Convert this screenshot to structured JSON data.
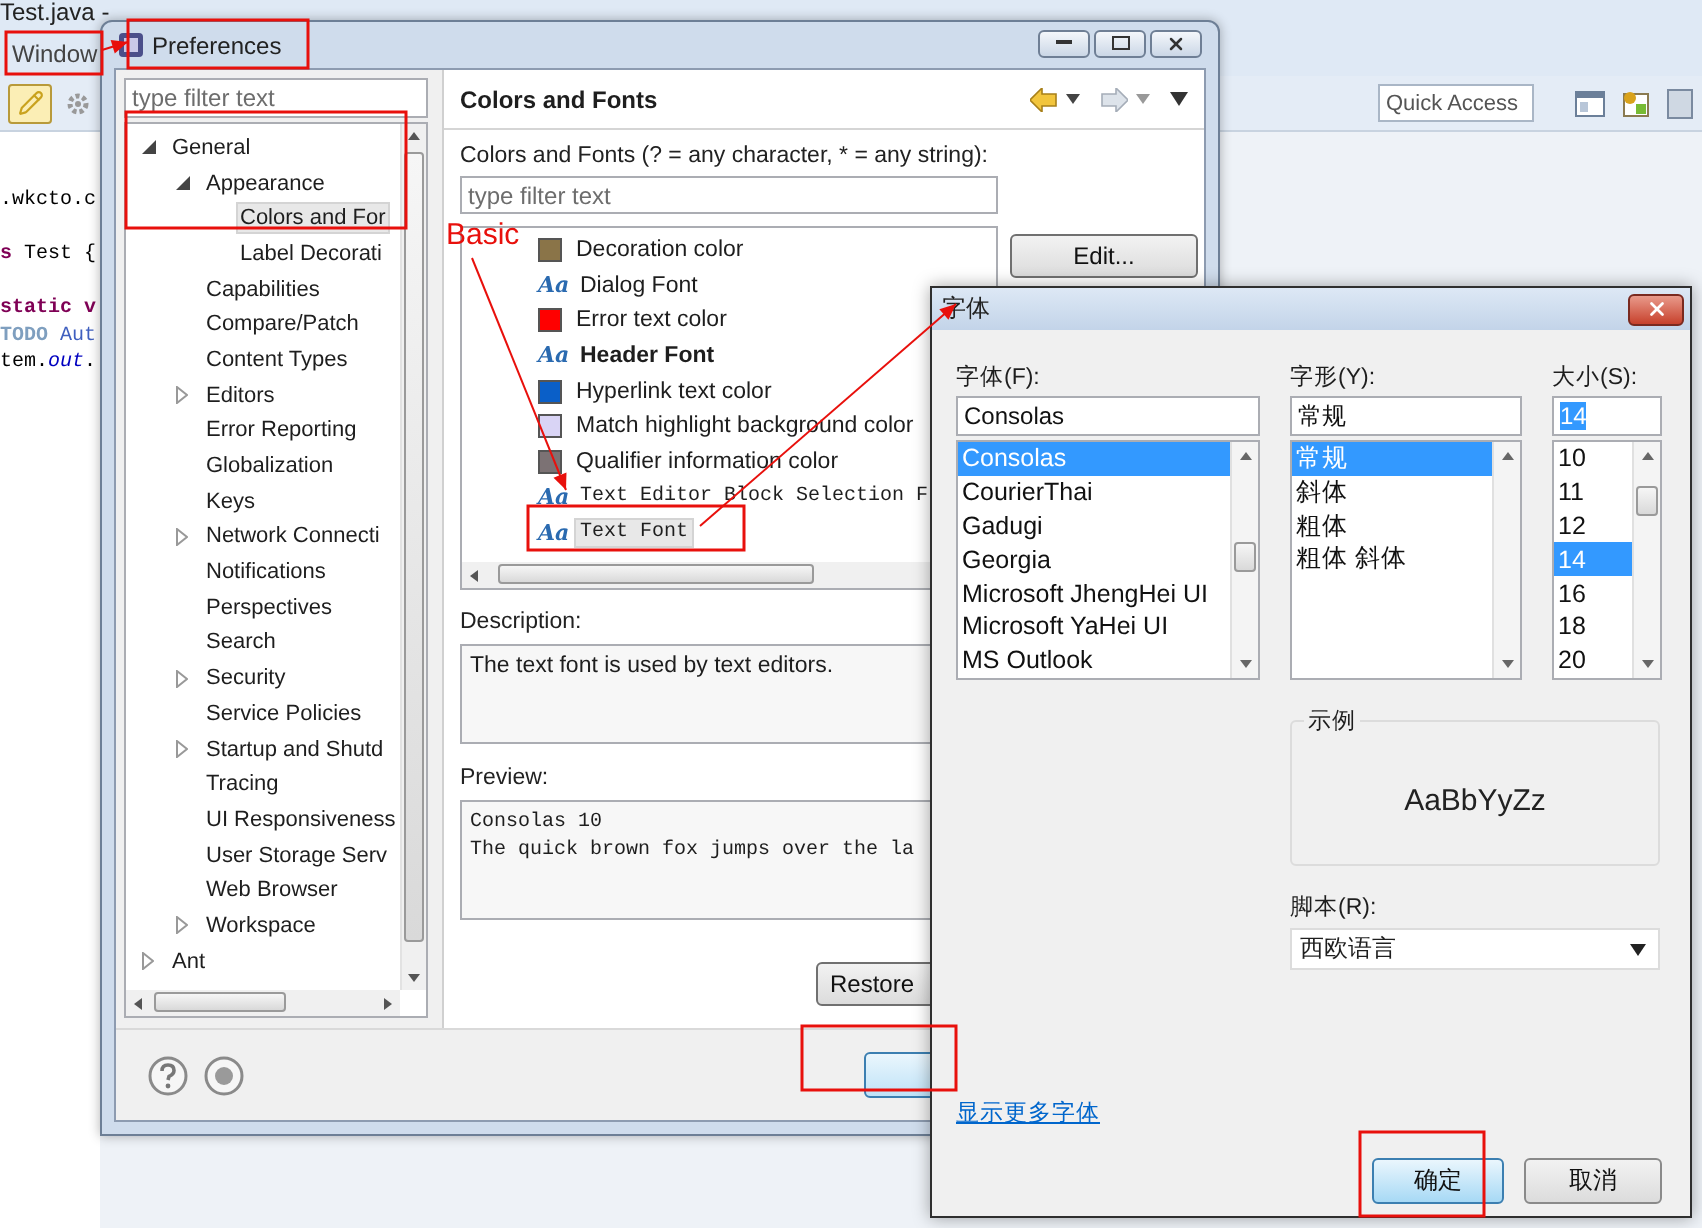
{
  "editor": {
    "title": "Test.java -",
    "menu": [
      {
        "label": "Window"
      }
    ],
    "quick_access": {
      "placeholder": "Quick Access"
    },
    "code_lines": [
      {
        "segments": [
          {
            "text": ".wkcto.c",
            "kind": "plain"
          }
        ]
      },
      {
        "segments": [
          {
            "text": "s",
            "kind": "keyword"
          },
          {
            "text": " Test {",
            "kind": "plain"
          }
        ]
      },
      {
        "segments": [
          {
            "text": "static v",
            "kind": "keyword"
          }
        ]
      },
      {
        "segments": [
          {
            "text": "TODO",
            "kind": "comment_tag"
          },
          {
            "text": " Aut",
            "kind": "comment"
          }
        ]
      },
      {
        "segments": [
          {
            "text": "tem.",
            "kind": "plain"
          },
          {
            "text": "out",
            "kind": "field"
          },
          {
            "text": ".",
            "kind": "plain"
          }
        ]
      }
    ]
  },
  "preferences": {
    "title": "Preferences",
    "filter": {
      "placeholder": "type filter text"
    },
    "tree": [
      {
        "label": "General",
        "expanded": true,
        "selected": false,
        "children": [
          {
            "label": "Appearance",
            "expanded": true,
            "selected": false,
            "children": [
              {
                "label": "Colors and For",
                "selected": true
              },
              {
                "label": "Label Decorati",
                "selected": false
              }
            ]
          },
          {
            "label": "Capabilities",
            "selected": false
          },
          {
            "label": "Compare/Patch",
            "selected": false
          },
          {
            "label": "Content Types",
            "selected": false
          },
          {
            "label": "Editors",
            "expanded": false,
            "selected": false
          },
          {
            "label": "Error Reporting",
            "selected": false
          },
          {
            "label": "Globalization",
            "selected": false
          },
          {
            "label": "Keys",
            "selected": false
          },
          {
            "label": "Network Connecti",
            "expanded": false,
            "selected": false
          },
          {
            "label": "Notifications",
            "selected": false
          },
          {
            "label": "Perspectives",
            "selected": false
          },
          {
            "label": "Search",
            "selected": false
          },
          {
            "label": "Security",
            "expanded": false,
            "selected": false
          },
          {
            "label": "Service Policies",
            "selected": false
          },
          {
            "label": "Startup and Shutd",
            "expanded": false,
            "selected": false
          },
          {
            "label": "Tracing",
            "selected": false
          },
          {
            "label": "UI Responsiveness",
            "selected": false
          },
          {
            "label": "User Storage Serv",
            "selected": false
          },
          {
            "label": "Web Browser",
            "selected": false
          },
          {
            "label": "Workspace",
            "expanded": false,
            "selected": false
          }
        ]
      },
      {
        "label": "Ant",
        "expanded": false,
        "selected": false
      }
    ],
    "page": {
      "title": "Colors and Fonts",
      "filter_label": "Colors and Fonts (? = any character, * = any string):",
      "filter": {
        "placeholder": "type filter text"
      },
      "items": [
        {
          "kind": "color",
          "label": "Decoration color",
          "color": "#8a7448",
          "selected": false
        },
        {
          "kind": "font",
          "glyph": "Aa",
          "label": "Dialog Font",
          "bold": false,
          "fixed_width": false,
          "selected": false
        },
        {
          "kind": "color",
          "label": "Error text color",
          "color": "#ff0000",
          "selected": false
        },
        {
          "kind": "font",
          "glyph": "Aa",
          "label": "Header Font",
          "bold": true,
          "fixed_width": false,
          "selected": false
        },
        {
          "kind": "color",
          "label": "Hyperlink text color",
          "color": "#0a5fc8",
          "selected": false
        },
        {
          "kind": "color",
          "label": "Match highlight background color",
          "color": "#d9d4f5",
          "selected": false
        },
        {
          "kind": "color",
          "label": "Qualifier information color",
          "color": "#7c7274",
          "selected": false
        },
        {
          "kind": "font",
          "glyph": "Aa",
          "label": "Text Editor Block Selection F",
          "bold": false,
          "fixed_width": true,
          "selected": false
        },
        {
          "kind": "font",
          "glyph": "Aa",
          "label": "Text Font",
          "bold": false,
          "fixed_width": true,
          "selected": true
        }
      ],
      "edit_button": "Edit...",
      "description_label": "Description:",
      "description": "The text font is used by text editors.",
      "preview_label": "Preview:",
      "preview": [
        "Consolas 10",
        "The quick brown fox jumps over the la"
      ],
      "restore_button": "Restore"
    }
  },
  "font_dialog": {
    "title": "字体",
    "columns": [
      {
        "label": "字体(F):",
        "value": "Consolas",
        "value_selected": false,
        "options": [
          {
            "label": "Consolas",
            "selected": true
          },
          {
            "label": "CourierThai",
            "selected": false
          },
          {
            "label": "Gadugi",
            "selected": false
          },
          {
            "label": "Georgia",
            "selected": false
          },
          {
            "label": "Microsoft JhengHei UI",
            "selected": false
          },
          {
            "label": "Microsoft YaHei UI",
            "selected": false
          },
          {
            "label": "MS Outlook",
            "selected": false
          }
        ]
      },
      {
        "label": "字形(Y):",
        "value": "常规",
        "value_selected": false,
        "options": [
          {
            "label": "常规",
            "selected": true
          },
          {
            "label": "斜体",
            "selected": false
          },
          {
            "label": "粗体",
            "selected": false
          },
          {
            "label": "粗体 斜体",
            "selected": false
          }
        ]
      },
      {
        "label": "大小(S):",
        "value": "14",
        "value_selected": true,
        "options": [
          {
            "label": "10",
            "selected": false
          },
          {
            "label": "11",
            "selected": false
          },
          {
            "label": "12",
            "selected": false
          },
          {
            "label": "14",
            "selected": true
          },
          {
            "label": "16",
            "selected": false
          },
          {
            "label": "18",
            "selected": false
          },
          {
            "label": "20",
            "selected": false
          }
        ]
      }
    ],
    "sample": {
      "label": "示例",
      "text": "AaBbYyZz"
    },
    "script": {
      "label": "脚本(R):",
      "value": "西欧语言"
    },
    "more_fonts_link": "显示更多字体",
    "buttons": [
      {
        "label": "确定",
        "default": true
      },
      {
        "label": "取消",
        "default": false
      }
    ]
  },
  "annotation": {
    "label": "Basic"
  }
}
